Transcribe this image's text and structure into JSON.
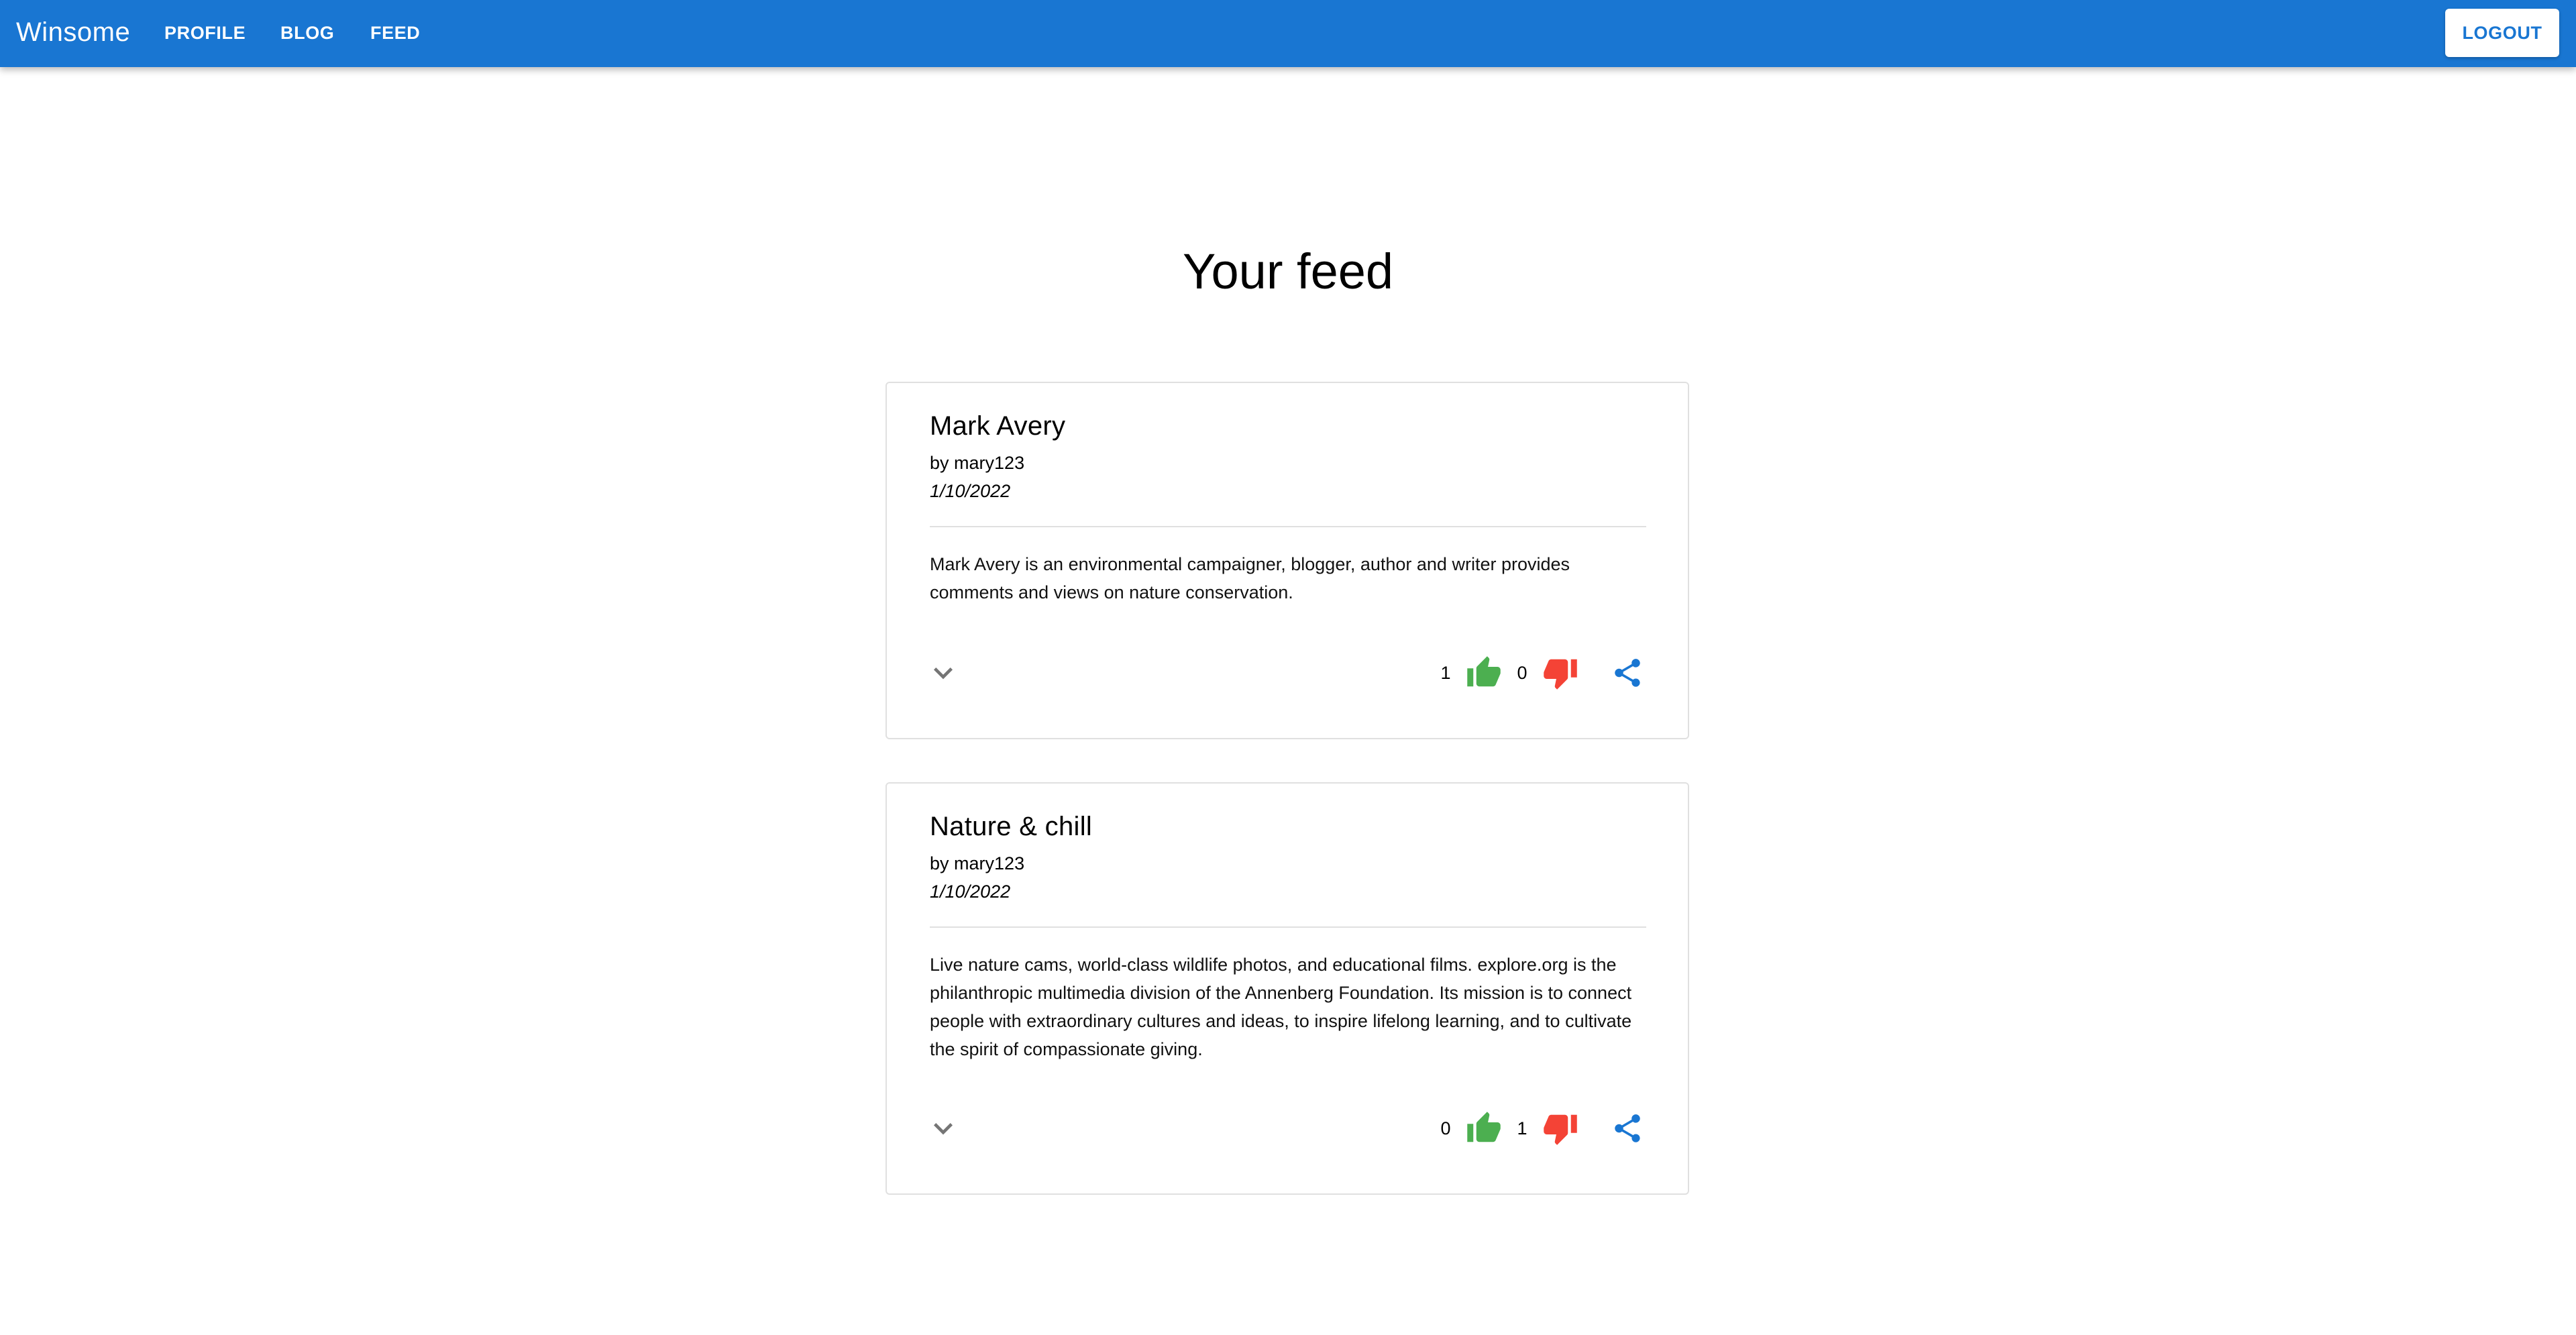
{
  "app": {
    "brand": "Winsome",
    "nav": [
      {
        "label": "PROFILE"
      },
      {
        "label": "BLOG"
      },
      {
        "label": "FEED"
      }
    ],
    "logout_label": "LOGOUT"
  },
  "page": {
    "title": "Your feed"
  },
  "colors": {
    "appbar": "#1976d2",
    "like": "#4caf50",
    "dislike": "#f44336",
    "share": "#1976d2"
  },
  "posts": [
    {
      "title": "Mark Avery",
      "author_prefix": "by",
      "author": "mary123",
      "date": "1/10/2022",
      "body": "Mark Avery is an environmental campaigner, blogger, author and writer provides comments and views on nature conservation.",
      "likes": "1",
      "dislikes": "0",
      "icons": {
        "expand": "chevron-down-icon",
        "like": "thumb-up-icon",
        "dislike": "thumb-down-icon",
        "share": "share-icon"
      }
    },
    {
      "title": "Nature & chill",
      "author_prefix": "by",
      "author": "mary123",
      "date": "1/10/2022",
      "body": "Live nature cams, world-class wildlife photos, and educational films. explore.org is the philanthropic multimedia division of the Annenberg Foundation. Its mission is to connect people with extraordinary cultures and ideas, to inspire lifelong learning, and to cultivate the spirit of compassionate giving.",
      "likes": "0",
      "dislikes": "1",
      "icons": {
        "expand": "chevron-down-icon",
        "like": "thumb-up-icon",
        "dislike": "thumb-down-icon",
        "share": "share-icon"
      }
    }
  ]
}
